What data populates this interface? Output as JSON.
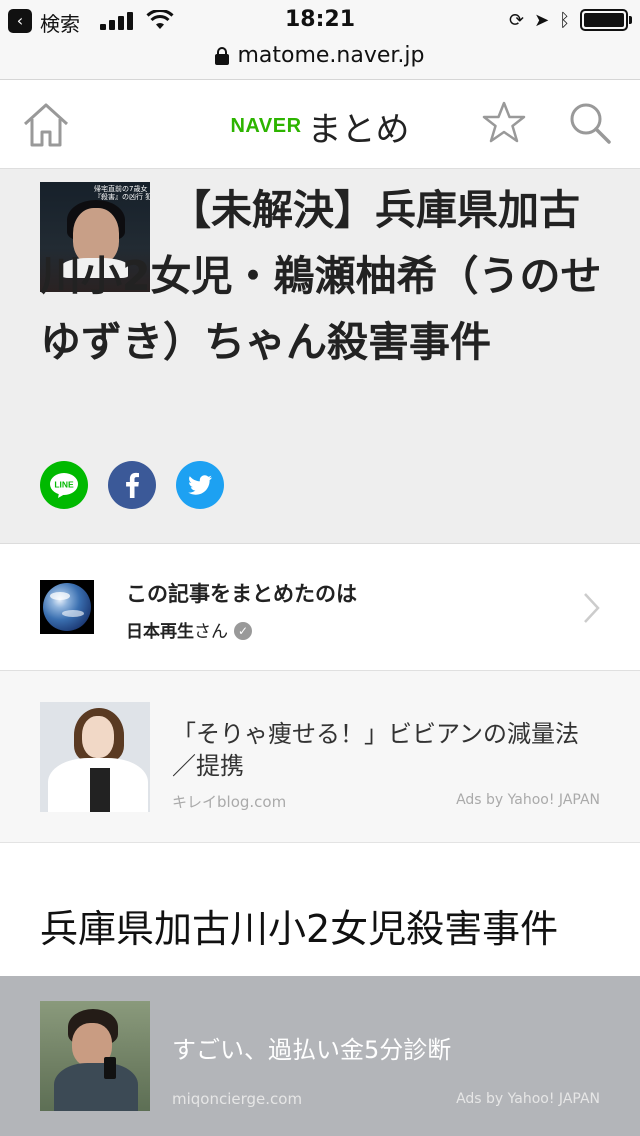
{
  "status_bar": {
    "back_app": "検索",
    "time": "18:21"
  },
  "browser": {
    "url": "matome.naver.jp"
  },
  "header": {
    "logo_naver": "NAVER",
    "logo_matome": "まとめ"
  },
  "article": {
    "title": "【未解決】兵庫県加古川小2女児・鵜瀬柚希（うのせ ゆずき）ちゃん殺害事件",
    "thumbnail_caption": "帰宅直前の7歳女\n『殺害』の凶行 犯人",
    "share_buttons": [
      "LINE",
      "facebook",
      "twitter"
    ]
  },
  "curator": {
    "label": "この記事をまとめたのは",
    "name": "日本再生",
    "honorific": "さん"
  },
  "ads": [
    {
      "title": "「そりゃ痩せる！」ビビアンの減量法／提携",
      "source": "キレイblog.com",
      "provider": "Ads by Yahoo! JAPAN"
    },
    {
      "title": "すごい、過払い金5分診断",
      "source": "miqoncierge.com",
      "provider": "Ads by Yahoo! JAPAN"
    }
  ],
  "section": {
    "heading": "兵庫県加古川小2女児殺害事件"
  },
  "colors": {
    "naver_green": "#2db400",
    "line_green": "#00b900",
    "facebook_blue": "#3b5998",
    "twitter_blue": "#1da1f2"
  }
}
